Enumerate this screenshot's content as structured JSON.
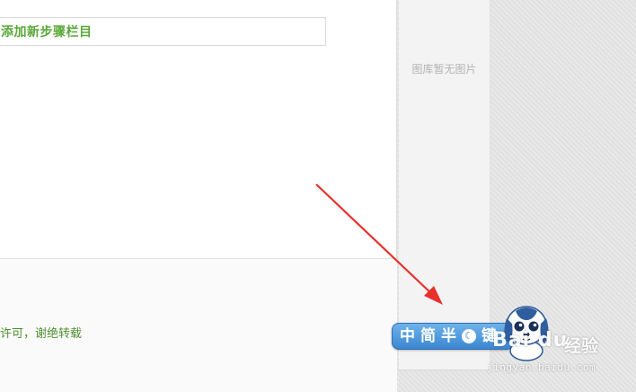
{
  "editor": {
    "add_step_label": "添加新步骤栏目",
    "copyright_note": "许可，谢绝转载"
  },
  "gallery": {
    "empty_text": "图库暂无图片"
  },
  "ime_toolbar": {
    "segments": [
      "中",
      "简",
      "半",
      "键"
    ]
  },
  "watermark": {
    "logo": "Bai du",
    "jingyan": "经验",
    "url": "jingyan.baidu.com"
  },
  "colors": {
    "accent_green": "#5aa83a",
    "arrow_red": "#e8302c",
    "ime_blue": "#3b86d1"
  },
  "icons": {
    "arrow": "annotation-arrow",
    "mascot": "baidu-puppy-mascot",
    "paw": "paw-icon"
  }
}
